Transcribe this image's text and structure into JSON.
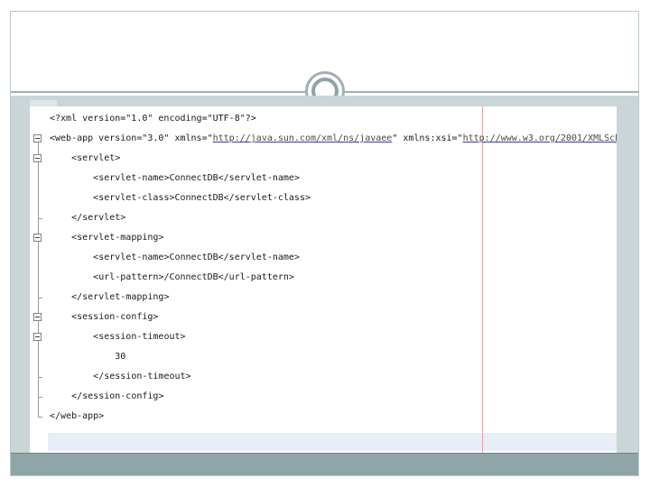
{
  "editor": {
    "lines": [
      {
        "indent": "",
        "parts": [
          {
            "t": "<?xml version=\"1.0\" encoding=\"UTF-8\"?>"
          }
        ]
      },
      {
        "indent": "",
        "parts": [
          {
            "t": "<web-app version=\"3.0\" xmlns=\""
          },
          {
            "t": "http://java.sun.com/xml/ns/javaee",
            "url": true
          },
          {
            "t": "\" xmlns:xsi=\""
          },
          {
            "t": "http://www.w3.org/2001/XMLSch",
            "url": true
          }
        ]
      },
      {
        "indent": "    ",
        "parts": [
          {
            "t": "<servlet>"
          }
        ]
      },
      {
        "indent": "        ",
        "parts": [
          {
            "t": "<servlet-name>ConnectDB</servlet-name>"
          }
        ]
      },
      {
        "indent": "        ",
        "parts": [
          {
            "t": "<servlet-class>ConnectDB</servlet-class>"
          }
        ]
      },
      {
        "indent": "    ",
        "parts": [
          {
            "t": "</servlet>"
          }
        ]
      },
      {
        "indent": "    ",
        "parts": [
          {
            "t": "<servlet-mapping>"
          }
        ]
      },
      {
        "indent": "        ",
        "parts": [
          {
            "t": "<servlet-name>ConnectDB</servlet-name>"
          }
        ]
      },
      {
        "indent": "        ",
        "parts": [
          {
            "t": "<url-pattern>/ConnectDB</url-pattern>"
          }
        ]
      },
      {
        "indent": "    ",
        "parts": [
          {
            "t": "</servlet-mapping>"
          }
        ]
      },
      {
        "indent": "    ",
        "parts": [
          {
            "t": "<session-config>"
          }
        ]
      },
      {
        "indent": "        ",
        "parts": [
          {
            "t": "<session-timeout>"
          }
        ]
      },
      {
        "indent": "            ",
        "parts": [
          {
            "t": "30"
          }
        ]
      },
      {
        "indent": "        ",
        "parts": [
          {
            "t": "</session-timeout>"
          }
        ]
      },
      {
        "indent": "    ",
        "parts": [
          {
            "t": "</session-config>"
          }
        ]
      },
      {
        "indent": "",
        "parts": [
          {
            "t": "</web-app>"
          }
        ]
      }
    ]
  },
  "colors": {
    "accent": "#9fb0b3",
    "bottom_band": "#8fa5a8",
    "margin_line": "#e7a3a3",
    "url_underline": "#3a3aa0"
  }
}
